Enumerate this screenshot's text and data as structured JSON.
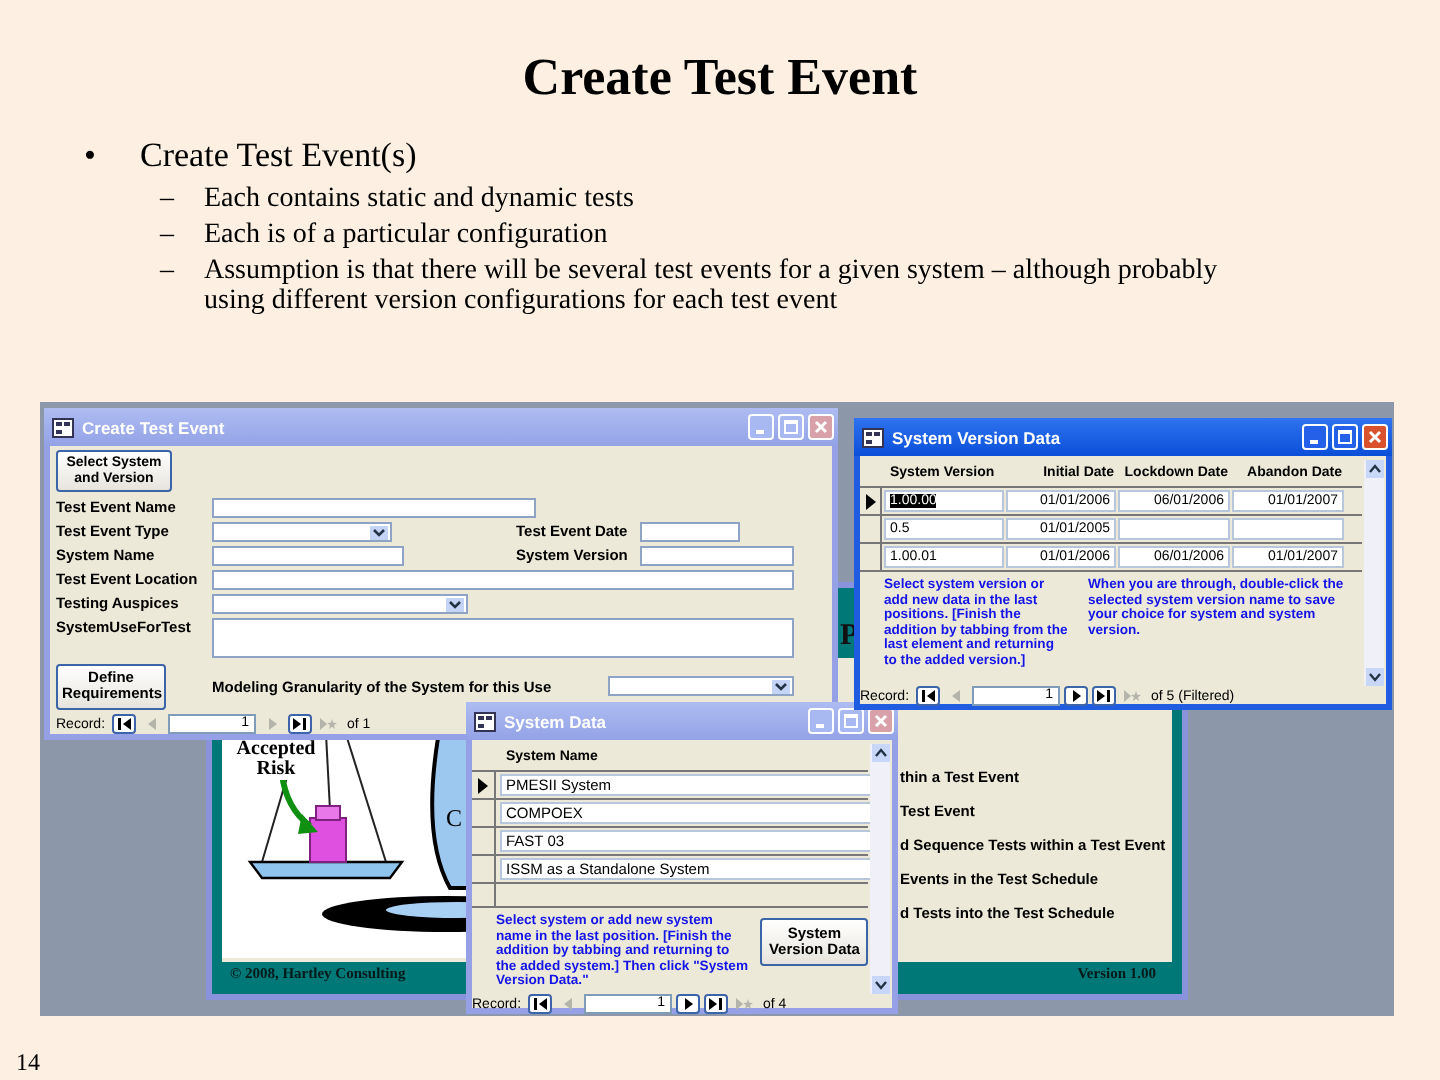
{
  "slide": {
    "title": "Create Test Event",
    "bullets": [
      {
        "marker": "•",
        "text": "Create Test Event(s)",
        "children": [
          {
            "marker": "–",
            "text": "Each contains static and dynamic tests"
          },
          {
            "marker": "–",
            "text": "Each is of a particular configuration"
          },
          {
            "marker": "–",
            "text": "Assumption is that there will be several test events for a given system – although probably using different version configurations for each test event"
          }
        ]
      }
    ],
    "page_number": "14"
  },
  "switchboard": {
    "header_fragment": "P",
    "picture_fragment": "C",
    "picture_label": "Accepted Risk",
    "menu_items": [
      "thin a Test Event",
      "Test Event",
      "d Sequence Tests within a Test Event",
      "Events in the Test Schedule",
      "d Tests into the Test Schedule"
    ],
    "copyright": "© 2008, Hartley Consulting",
    "version": "Version 1.00"
  },
  "create_test_event": {
    "title": "Create Test Event",
    "active": false,
    "select_button": "Select System and Version",
    "fields": [
      {
        "label": "Test Event Name",
        "kind": "text"
      },
      {
        "label": "Test Event Type",
        "kind": "dropdown",
        "side": {
          "label": "Test Event Date",
          "kind": "text"
        }
      },
      {
        "label": "System Name",
        "kind": "text",
        "side": {
          "label": "System Version",
          "kind": "text"
        }
      },
      {
        "label": "Test Event Location",
        "kind": "text"
      },
      {
        "label": "Testing Auspices",
        "kind": "dropdown"
      },
      {
        "label": "SystemUseForTest",
        "kind": "memo"
      }
    ],
    "define_button": "Define Requirements",
    "granularity": {
      "label": "Modeling Granularity of the System for this Use",
      "kind": "dropdown"
    },
    "record": {
      "label": "Record:",
      "current": "1",
      "total": "of 1",
      "buttons": [
        {
          "kind": "first",
          "disabled": false
        },
        {
          "kind": "prev",
          "disabled": true
        },
        {
          "kind": "next",
          "disabled": true
        },
        {
          "kind": "last",
          "disabled": false
        },
        {
          "kind": "new",
          "disabled": true
        }
      ]
    }
  },
  "system_version_data": {
    "title": "System Version Data",
    "active": true,
    "columns": [
      "System Version",
      "Initial Date",
      "Lockdown Date",
      "Abandon Date"
    ],
    "rows": [
      {
        "current": true,
        "cells": [
          "1.00.00",
          "01/01/2006",
          "06/01/2006",
          "01/01/2007"
        ]
      },
      {
        "current": false,
        "cells": [
          "0.5",
          "01/01/2005",
          null,
          null
        ]
      },
      {
        "current": false,
        "cells": [
          "1.00.01",
          "01/01/2006",
          "06/01/2006",
          "01/01/2007"
        ]
      }
    ],
    "notes": [
      "Select system version or add new data in the last positions. [Finish the addition by tabbing from the last element and returning to the added version.]",
      "When you are through, double-click the selected system version name to save your choice for system and system version."
    ],
    "record": {
      "label": "Record:",
      "current": "1",
      "total": "of 5 (Filtered)",
      "buttons": [
        {
          "kind": "first",
          "disabled": false
        },
        {
          "kind": "prev",
          "disabled": true
        },
        {
          "kind": "next",
          "disabled": false
        },
        {
          "kind": "last",
          "disabled": false
        },
        {
          "kind": "new",
          "disabled": true
        }
      ]
    }
  },
  "system_data": {
    "title": "System Data",
    "active": false,
    "column": "System Name",
    "rows": [
      {
        "current": true,
        "name": "PMESII System"
      },
      {
        "current": false,
        "name": "COMPOEX"
      },
      {
        "current": false,
        "name": "FAST 03"
      },
      {
        "current": false,
        "name": "ISSM as a Standalone System"
      }
    ],
    "note": "Select system or add new system name in the last position. [Finish the addition by tabbing and returning to the added system.] Then click \"System Version Data.\"",
    "button": "System Version Data",
    "record": {
      "label": "Record:",
      "current": "1",
      "total": "of 4",
      "buttons": [
        {
          "kind": "first",
          "disabled": false
        },
        {
          "kind": "prev",
          "disabled": true
        },
        {
          "kind": "next",
          "disabled": false
        },
        {
          "kind": "last",
          "disabled": false
        },
        {
          "kind": "new",
          "disabled": true
        }
      ]
    }
  }
}
